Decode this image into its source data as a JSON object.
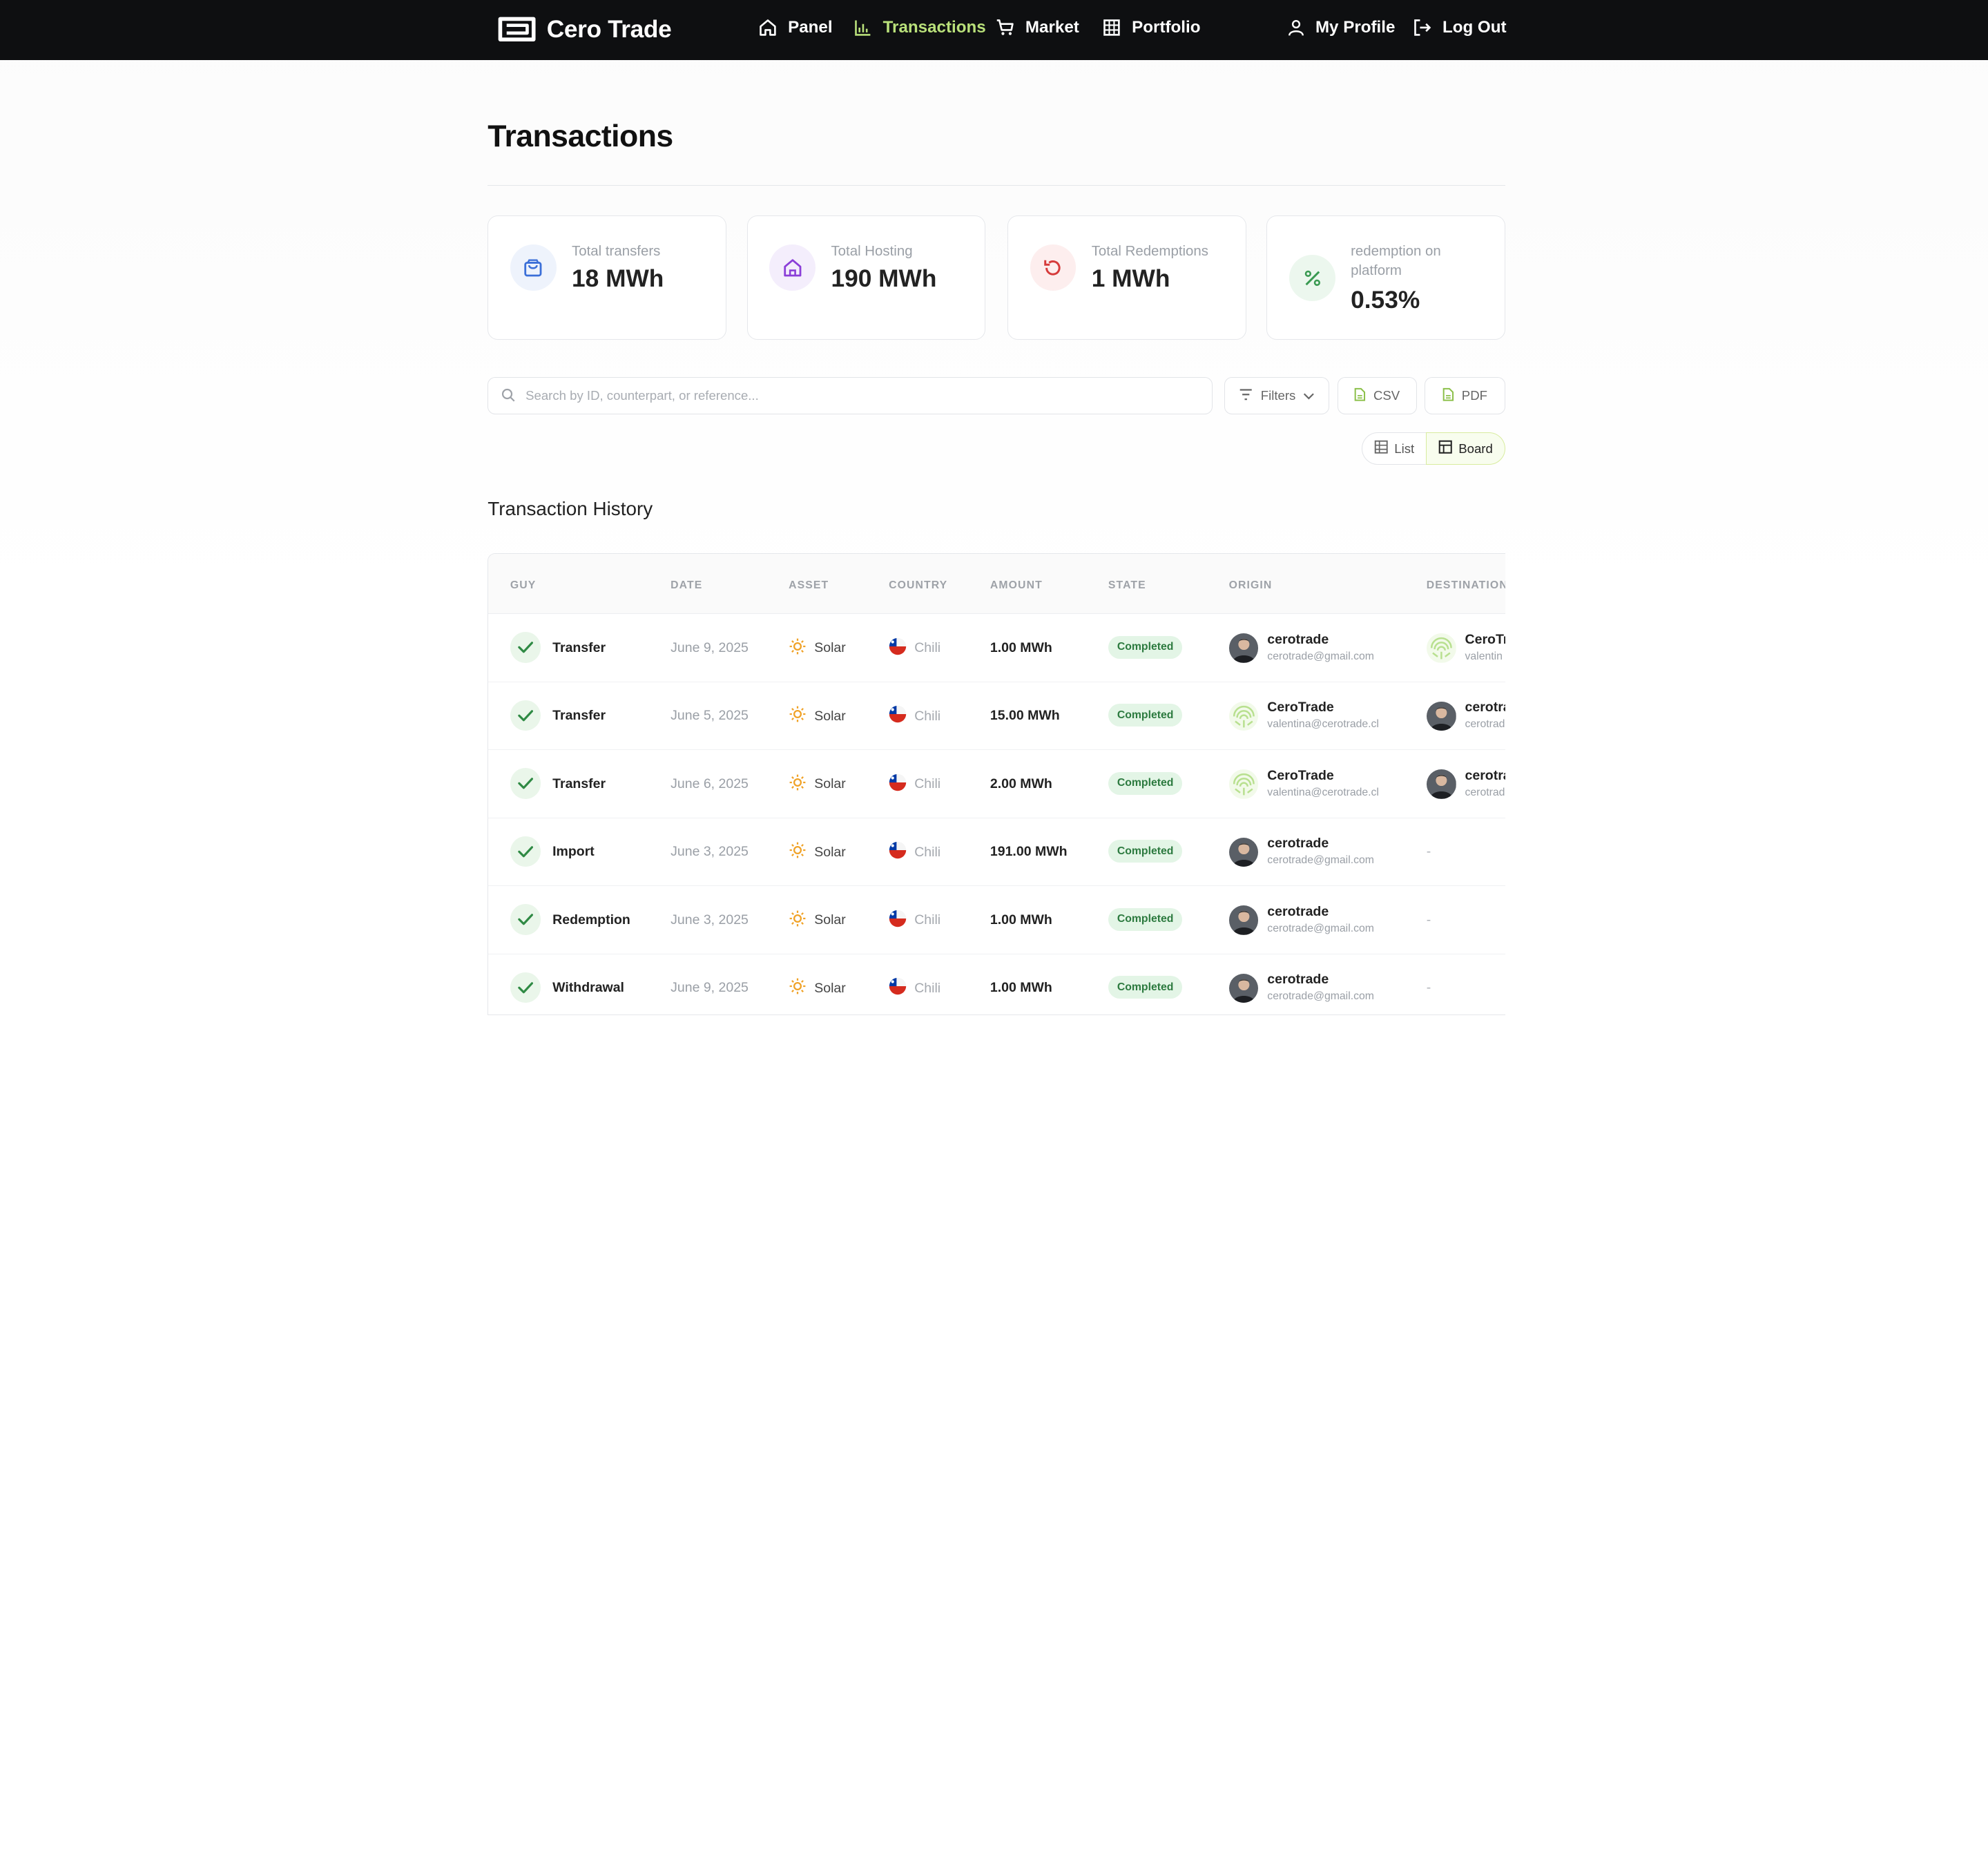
{
  "brand": {
    "name": "Cero Trade"
  },
  "nav": {
    "panel": "Panel",
    "transactions": "Transactions",
    "market": "Market",
    "portfolio": "Portfolio",
    "profile": "My Profile",
    "logout": "Log Out"
  },
  "page": {
    "title": "Transactions"
  },
  "stats": [
    {
      "label": "Total transfers",
      "value": "18 MWh",
      "icon": "shopping-bag-icon",
      "color": "#3b6fd8"
    },
    {
      "label": "Total Hosting",
      "value": "190 MWh",
      "icon": "home-icon",
      "color": "#8b3fd8"
    },
    {
      "label": "Total Redemptions",
      "value": "1 MWh",
      "icon": "refresh-icon",
      "color": "#d63b3b"
    },
    {
      "label": "redemption on platform",
      "value": "0.53%",
      "icon": "percent-icon",
      "color": "#3a9a52"
    }
  ],
  "search": {
    "placeholder": "Search by ID, counterpart, or reference..."
  },
  "buttons": {
    "filters": "Filters",
    "csv": "CSV",
    "pdf": "PDF",
    "list": "List",
    "board": "Board"
  },
  "section": {
    "title": "Transaction History"
  },
  "table": {
    "headers": {
      "guy": "GUY",
      "date": "DATE",
      "asset": "ASSET",
      "country": "COUNTRY",
      "amount": "AMOUNT",
      "state": "STATE",
      "origin": "ORIGIN",
      "destination": "DESTINATION"
    },
    "rows": [
      {
        "type": "Transfer",
        "date": "June 9, 2025",
        "asset": "Solar",
        "country": "Chili",
        "amount": "1.00 MWh",
        "state": "Completed",
        "origin": {
          "name": "cerotrade",
          "email": "cerotrade@gmail.com"
        },
        "destination": {
          "name": "CeroTr",
          "email": "valentin"
        }
      },
      {
        "type": "Transfer",
        "date": "June 5, 2025",
        "asset": "Solar",
        "country": "Chili",
        "amount": "15.00 MWh",
        "state": "Completed",
        "origin": {
          "name": "CeroTrade",
          "email": "valentina@cerotrade.cl"
        },
        "destination": {
          "name": "cerotra",
          "email": "cerotrad"
        }
      },
      {
        "type": "Transfer",
        "date": "June 6, 2025",
        "asset": "Solar",
        "country": "Chili",
        "amount": "2.00 MWh",
        "state": "Completed",
        "origin": {
          "name": "CeroTrade",
          "email": "valentina@cerotrade.cl"
        },
        "destination": {
          "name": "cerotra",
          "email": "cerotrad"
        }
      },
      {
        "type": "Import",
        "date": "June 3, 2025",
        "asset": "Solar",
        "country": "Chili",
        "amount": "191.00 MWh",
        "state": "Completed",
        "origin": {
          "name": "cerotrade",
          "email": "cerotrade@gmail.com"
        },
        "destination": "-"
      },
      {
        "type": "Redemption",
        "date": "June 3, 2025",
        "asset": "Solar",
        "country": "Chili",
        "amount": "1.00 MWh",
        "state": "Completed",
        "origin": {
          "name": "cerotrade",
          "email": "cerotrade@gmail.com"
        },
        "destination": "-"
      },
      {
        "type": "Withdrawal",
        "date": "June 9, 2025",
        "asset": "Solar",
        "country": "Chili",
        "amount": "1.00 MWh",
        "state": "Completed",
        "origin": {
          "name": "cerotrade",
          "email": "cerotrade@gmail.com"
        },
        "destination": "-"
      }
    ]
  },
  "colors": {
    "accent": "#b9e07a",
    "nav_bg": "#0e0f11",
    "success": "#2c7a3f"
  }
}
